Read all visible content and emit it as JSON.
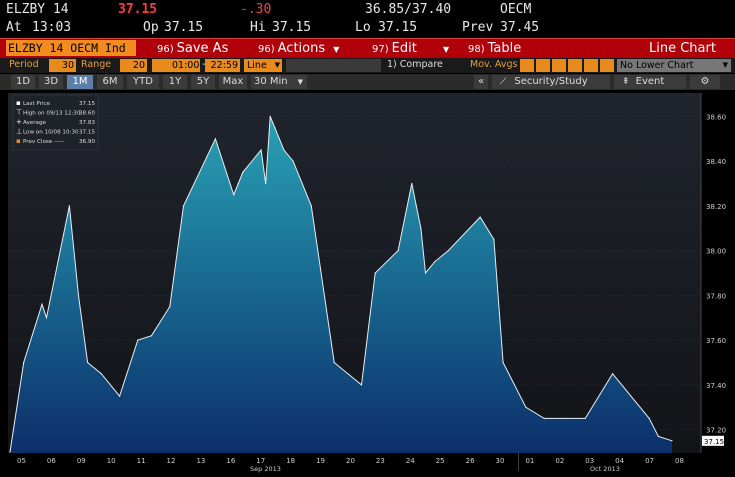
{
  "quote": {
    "ticker": "ELZBY 14",
    "last": "37.15",
    "change": "-.30",
    "bid_ask": "36.85/37.40",
    "exchange": "OECM",
    "time_label": "At",
    "time": "13:03",
    "open_label": "Op",
    "open": "37.15",
    "high_label": "Hi",
    "high": "37.15",
    "low_label": "Lo",
    "low": "37.15",
    "prev_label": "Prev",
    "prev": "37.45"
  },
  "toolbar": {
    "security": "ELZBY 14 OECM Ind",
    "save": {
      "num": "96)",
      "label": "Save As"
    },
    "actions": {
      "num": "96)",
      "label": "Actions"
    },
    "edit": {
      "num": "97)",
      "label": "Edit"
    },
    "table": {
      "num": "98)",
      "label": "Table"
    },
    "title": "Line Chart"
  },
  "settings": {
    "period_label": "Period",
    "period_value": "30",
    "range_label": "Range",
    "range_value": "20",
    "time_start": "01:00",
    "time_sep": "-",
    "time_end": "22:59",
    "chart_style": "Line",
    "compare": "1) Compare",
    "mov_avgs": "Mov. Avgs",
    "lower_chart": "No Lower Chart"
  },
  "range_tabs": [
    "1D",
    "3D",
    "1M",
    "6M",
    "YTD",
    "1Y",
    "5Y",
    "Max",
    "30 Min"
  ],
  "active_tab": "1M",
  "right_tabs": {
    "collapse": "«",
    "security_study": "Security/Study",
    "event": "Event",
    "gear": "⚙"
  },
  "legend": [
    {
      "label": "Last Price",
      "value": "37.15"
    },
    {
      "label": "High on 09/13 12:30",
      "value": "38.60"
    },
    {
      "label": "Average",
      "value": "37.83"
    },
    {
      "label": "Low on 10/08 10:30",
      "value": "37.15"
    },
    {
      "label": "Prev Close -----",
      "value": "36.90"
    }
  ],
  "chart_data": {
    "type": "area",
    "last_price_tag": "37.15",
    "y_ticks": [
      "38.60",
      "38.40",
      "38.20",
      "38.00",
      "37.80",
      "37.60",
      "37.40",
      "37.20"
    ],
    "x_ticks": [
      "05",
      "06",
      "09",
      "10",
      "11",
      "12",
      "13",
      "16",
      "17",
      "18",
      "19",
      "20",
      "23",
      "24",
      "25",
      "26",
      "30",
      "01",
      "02",
      "03",
      "04",
      "07",
      "08"
    ],
    "month_labels": [
      "Sep 2013",
      "Oct 2013"
    ],
    "x_axis_points": [
      0,
      3,
      7,
      8,
      13,
      15,
      17,
      20,
      24,
      28,
      31,
      35,
      38,
      45,
      49,
      50,
      51,
      55,
      56,
      57,
      58,
      59,
      60,
      62,
      66,
      71,
      77,
      80,
      85,
      88,
      89,
      90,
      91,
      93,
      96,
      103,
      106,
      108,
      113,
      117,
      121,
      126,
      132,
      140,
      142,
      145
    ],
    "values": [
      37.1,
      37.5,
      37.76,
      37.7,
      38.2,
      37.8,
      37.5,
      37.45,
      37.35,
      37.6,
      37.62,
      37.75,
      38.2,
      38.5,
      38.25,
      38.3,
      38.35,
      38.45,
      38.3,
      38.6,
      38.55,
      38.5,
      38.45,
      38.4,
      38.2,
      37.5,
      37.4,
      37.9,
      38.0,
      38.3,
      38.2,
      38.1,
      37.9,
      37.95,
      38.0,
      38.15,
      38.05,
      37.5,
      37.3,
      37.25,
      37.25,
      37.25,
      37.45,
      37.25,
      37.17,
      37.15
    ],
    "ylim": [
      37.1,
      38.7
    ]
  }
}
